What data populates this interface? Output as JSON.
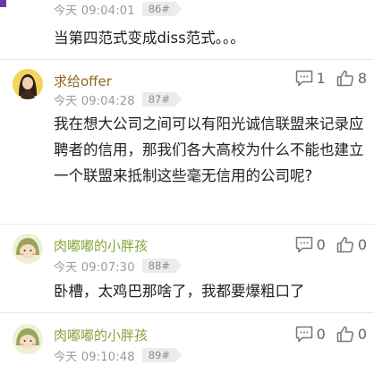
{
  "comments": [
    {
      "username": "",
      "time": "今天 09:04:01",
      "floor": "86#",
      "text": "当第四范式变成diss范式。。。",
      "reply_count": "",
      "like_count": ""
    },
    {
      "username": "求给offer",
      "time": "今天 09:04:28",
      "floor": "87#",
      "text": "我在想大公司之间可以有阳光诚信联盟来记录应聘者的信用，那我们各大高校为什么不能也建立一个联盟来抵制这些毫无信用的公司呢?",
      "reply_count": "1",
      "like_count": "8"
    },
    {
      "username": "肉嘟嘟的小胖孩",
      "time": "今天 09:07:30",
      "floor": "88#",
      "text": "卧槽，太鸡巴那啥了，我都要爆粗口了",
      "reply_count": "0",
      "like_count": "0"
    },
    {
      "username": "肉嘟嘟的小胖孩",
      "time": "今天 09:10:48",
      "floor": "89#",
      "text": "",
      "reply_count": "0",
      "like_count": "0"
    }
  ],
  "icons": {
    "reply": "comment-bubble-icon",
    "like": "thumbs-up-icon"
  },
  "colors": {
    "username_gold": "#8d6a1f",
    "username_green": "#86a43a",
    "accent_purple": "#6f3aa3"
  }
}
